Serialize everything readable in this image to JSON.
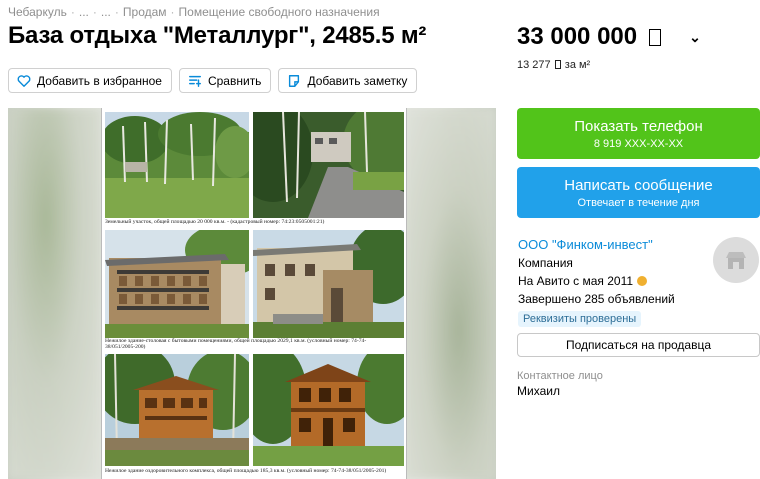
{
  "breadcrumb": [
    "Чебаркуль",
    "...",
    "...",
    "Продам",
    "Помещение свободного назначения"
  ],
  "title": "База отдыха \"Металлург\", 2485.5 м²",
  "actions": {
    "favorite": "Добавить в избранное",
    "compare": "Сравнить",
    "note": "Добавить заметку"
  },
  "price": {
    "value": "33 000 000",
    "per_sqm": "13 277",
    "per_sqm_unit": "за м²",
    "currency_icon": "ruble-icon"
  },
  "gallery": {
    "captions": [
      "Земельный участок, общей площадью 20 000 кв.м. - (кадастровый номер: 74:23:0505001:21)",
      "Нежилое здание-столовая с бытовыми помещениями, общей площадью 2029,1 кв.м. (условный номер: 74-74-",
      "38/051/2005-200)",
      "Нежилое здание оздоровительного комплекса, общей площадью 185,3 кв.м. (условный номер: 74-74-38/051/2005-201)"
    ]
  },
  "phone_button": {
    "label": "Показать телефон",
    "number": "8 919 XXX-XX-XX",
    "color": "#52c41a"
  },
  "message_button": {
    "label": "Написать сообщение",
    "sub": "Отвечает в течение дня",
    "color": "#21a1ea"
  },
  "seller": {
    "name": "ООО \"Финком-инвест\"",
    "type": "Компания",
    "since": "На Авито с мая 2011",
    "completed": "Завершено 285 объявлений",
    "badge": "Реквизиты проверены"
  },
  "subscribe_button": "Подписаться на продавца",
  "contact": {
    "label": "Контактное лицо",
    "name": "Михаил"
  }
}
